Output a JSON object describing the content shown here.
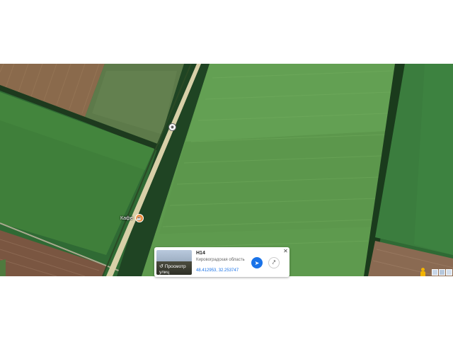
{
  "map": {
    "poi_label": "Кафе",
    "poi_icon": "cafe-pin-icon",
    "road_marker_icon": "road-shield-icon"
  },
  "info_card": {
    "thumbnail_label": "Просмотр улиц",
    "thumbnail_icon": "street-view-rotate-icon",
    "title": "H14",
    "subtitle": "Кировоградская область",
    "coordinates": "48.412953, 32.253747",
    "directions_icon": "directions-icon",
    "share_icon": "share-icon",
    "close_icon": "close-icon"
  },
  "controls": {
    "pegman_icon": "pegman-icon",
    "layers_icon": "layers-thumbnail-icon"
  },
  "colors": {
    "directions_button": "#1a73e8",
    "coordinates_link": "#1a73e8",
    "poi_pin": "#f08c3c",
    "pegman": "#f2b300"
  }
}
